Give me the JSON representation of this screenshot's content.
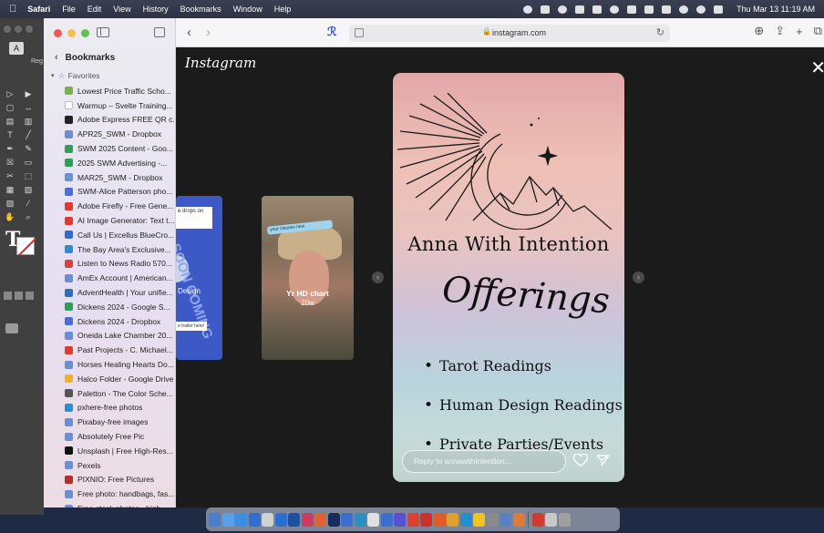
{
  "menubar": {
    "apple": "",
    "app": "Safari",
    "menus": [
      "File",
      "Edit",
      "View",
      "History",
      "Bookmarks",
      "Window",
      "Help"
    ],
    "clock": "Thu Mar 13  11:19 AM"
  },
  "bg_app": {
    "control_label": "A",
    "control_label2": "Reg"
  },
  "sidebar": {
    "title": "Bookmarks",
    "section": "Favorites",
    "items": [
      {
        "label": "Lowest Price Traffic Scho...",
        "color": "#7bb342"
      },
      {
        "label": "Warmup – Svelte Training...",
        "color": "#ffffff"
      },
      {
        "label": "Adobe Express FREE QR c...",
        "color": "#222222"
      },
      {
        "label": "APR25_SWM - Dropbox",
        "color": "#6a8fd4"
      },
      {
        "label": "SWM 2025 Content - Goo...",
        "color": "#2f9e5a"
      },
      {
        "label": "2025 SWM Advertising -...",
        "color": "#2f9e5a"
      },
      {
        "label": "MAR25_SWM - Dropbox",
        "color": "#6a8fd4"
      },
      {
        "label": "SWM-Alice Patterson pho...",
        "color": "#4a6fd0"
      },
      {
        "label": "Adobe Firefly - Free Gene...",
        "color": "#e03a2f"
      },
      {
        "label": "AI Image Generator: Text t...",
        "color": "#e03a2f"
      },
      {
        "label": "Call Us | Excellus BlueCro...",
        "color": "#2a6fd0"
      },
      {
        "label": "The Bay Area's Exclusive...",
        "color": "#2a8fd0"
      },
      {
        "label": "Listen to News Radio 570...",
        "color": "#e0403a"
      },
      {
        "label": "AmEx Account | American...",
        "color": "#6a8fd4"
      },
      {
        "label": "AdventHealth | Your unifie...",
        "color": "#2a6fc0"
      },
      {
        "label": "Dickens 2024 - Google S...",
        "color": "#2f9e5a"
      },
      {
        "label": "Dickens 2024 - Dropbox",
        "color": "#4a6fd0"
      },
      {
        "label": "Oneida Lake Chamber 20...",
        "color": "#6a8fd4"
      },
      {
        "label": "Past Projects - C. Michael...",
        "color": "#e03a2f"
      },
      {
        "label": "Horses Healing Hearts Do...",
        "color": "#6a8fd4"
      },
      {
        "label": "Halco Folder - Google Drive",
        "color": "#f2b01e"
      },
      {
        "label": "Paletton - The Color Sche...",
        "color": "#555555"
      },
      {
        "label": "pxhere-free photos",
        "color": "#2a8fd0"
      },
      {
        "label": "Pixabay-free images",
        "color": "#6a8fd4"
      },
      {
        "label": "Absolutely Free Pic",
        "color": "#6a8fd4"
      },
      {
        "label": "Unsplash | Free High-Res...",
        "color": "#111111"
      },
      {
        "label": "Pexels",
        "color": "#6a8fd4"
      },
      {
        "label": "PIXNIO: Free Pictures",
        "color": "#b0302a"
      },
      {
        "label": "Free photo: handbags, fas...",
        "color": "#6a8fd4"
      },
      {
        "label": "Free stock photos - high...",
        "color": "#6a8fd4"
      }
    ]
  },
  "toolbar": {
    "url": "instagram.com"
  },
  "instagram": {
    "logo": "Instagram",
    "story_left": {
      "pill_text": "e drops on",
      "soon_text": "SOON COMING",
      "trailer_text": "e trailer here!",
      "caption": "Design"
    },
    "story_mid": {
      "tag_text": "your classes new",
      "title": "Yr HD chart",
      "age": "20w"
    },
    "story_main": {
      "title": "Anna With Intention",
      "offerings": "Offerings",
      "services": [
        "Tarot Readings",
        "Human Design Readings",
        "Private Parties/Events"
      ]
    },
    "reply_placeholder": "Reply to annawithintention..."
  },
  "dock": {
    "icon_colors": [
      "#4a7fd0",
      "#5aa0e8",
      "#3a8fe0",
      "#2f6fd0",
      "#d0d0d0",
      "#2a6fd0",
      "#1f4fa0",
      "#d03a60",
      "#e0622f",
      "#1a2a5a",
      "#3a6fd0",
      "#2a90c0",
      "#e0e0e0",
      "#3a6fd0",
      "#5a4fd0",
      "#e0402f",
      "#d0302a",
      "#e05a2a",
      "#e0a02f",
      "#1f8fd0",
      "#f2c21e",
      "#8a8a8a",
      "#5a80c0",
      "#e07a3a",
      "#d03a2f",
      "#c8c8c8",
      "#a0a0a0"
    ]
  }
}
